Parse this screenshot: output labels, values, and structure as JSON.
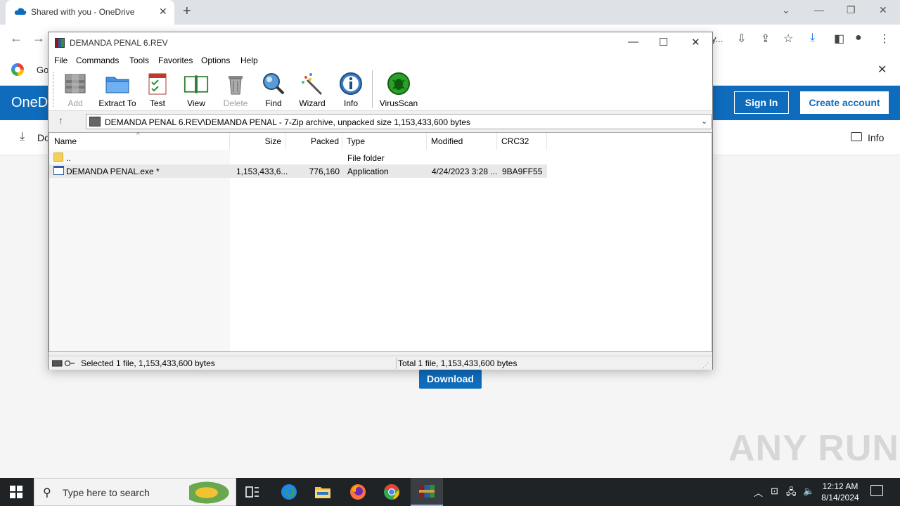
{
  "browser": {
    "tab_title": "Shared with you - OneDrive",
    "omnibox_tail": "y...",
    "bookmark_text": "Go"
  },
  "onedrive": {
    "brand": "OneD",
    "sign_in": "Sign In",
    "create_account": "Create account",
    "download_cmd": "Do",
    "info": "Info",
    "download_button": "Download"
  },
  "winrar": {
    "title": "DEMANDA PENAL 6.REV",
    "menu": [
      "File",
      "Commands",
      "Tools",
      "Favorites",
      "Options",
      "Help"
    ],
    "toolbar": [
      {
        "label": "Add",
        "icon": "add-archive-icon",
        "disabled": true
      },
      {
        "label": "Extract To",
        "icon": "extract-folder-icon",
        "disabled": false
      },
      {
        "label": "Test",
        "icon": "test-checklist-icon",
        "disabled": false
      },
      {
        "label": "View",
        "icon": "view-book-icon",
        "disabled": false
      },
      {
        "label": "Delete",
        "icon": "trash-icon",
        "disabled": true
      },
      {
        "label": "Find",
        "icon": "magnifier-icon",
        "disabled": false
      },
      {
        "label": "Wizard",
        "icon": "wand-icon",
        "disabled": false
      },
      {
        "label": "Info",
        "icon": "info-icon",
        "disabled": false
      },
      {
        "label": "VirusScan",
        "icon": "virusscan-icon",
        "disabled": false
      }
    ],
    "address": "DEMANDA PENAL 6.REV\\DEMANDA PENAL - 7-Zip archive, unpacked size 1,153,433,600 bytes",
    "columns": {
      "name": "Name",
      "size": "Size",
      "packed": "Packed",
      "type": "Type",
      "modified": "Modified",
      "crc": "CRC32"
    },
    "rows": [
      {
        "name": "..",
        "size": "",
        "packed": "",
        "type": "File folder",
        "modified": "",
        "crc": ""
      },
      {
        "name": "DEMANDA PENAL.exe *",
        "size": "1,153,433,6...",
        "packed": "776,160",
        "type": "Application",
        "modified": "4/24/2023 3:28 ...",
        "crc": "9BA9FF55"
      }
    ],
    "status_left": "Selected 1 file, 1,153,433,600 bytes",
    "status_right": "Total 1 file, 1,153,433,600 bytes"
  },
  "watermark": "ANY RUN",
  "taskbar": {
    "search_placeholder": "Type here to search",
    "time": "12:12 AM",
    "date": "8/14/2024"
  },
  "colors": {
    "onedrive_blue": "#0f6cbd",
    "taskbar": "#1f2326"
  }
}
